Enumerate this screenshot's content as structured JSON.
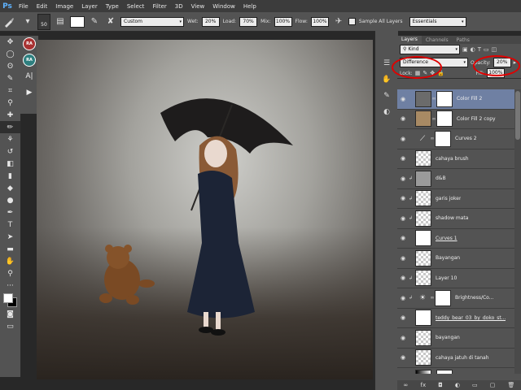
{
  "app": {
    "logo": "Ps"
  },
  "menu": [
    "File",
    "Edit",
    "Image",
    "Layer",
    "Type",
    "Select",
    "Filter",
    "3D",
    "View",
    "Window",
    "Help"
  ],
  "options": {
    "tool_icon": "brush-icon",
    "brush_size": "50",
    "preset": "Custom",
    "wet_label": "Wet:",
    "wet_value": "20%",
    "load_label": "Load:",
    "load_value": "70%",
    "mix_label": "Mix:",
    "mix_value": "100%",
    "flow_label": "Flow:",
    "flow_value": "100%",
    "sample_all_label": "Sample All Layers",
    "workspace": "Essentials"
  },
  "minipanel": {
    "badge1": "RA",
    "badge2": "RA"
  },
  "panel": {
    "tabs": [
      "Layers",
      "Channels",
      "Paths"
    ],
    "filter_kind": "Kind",
    "blend_mode": "Difference",
    "opacity_label": "Opacity:",
    "opacity_value": "20%",
    "lock_label": "Lock:",
    "fill_label": "Fill:",
    "fill_value": "100%"
  },
  "layers": [
    {
      "name": "Color Fill 2",
      "thumb": "gray",
      "mask": true,
      "clip": false,
      "active": true
    },
    {
      "name": "Color Fill 2 copy",
      "thumb": "brown",
      "mask": true,
      "clip": false,
      "active": false
    },
    {
      "name": "Curves 2",
      "thumb": "curves",
      "mask": true,
      "clip": false,
      "active": false
    },
    {
      "name": "cahaya brush",
      "thumb": "transparent",
      "mask": false,
      "clip": false,
      "active": false
    },
    {
      "name": "d&B",
      "thumb": "photo",
      "mask": false,
      "clip": true,
      "active": false
    },
    {
      "name": "garis joker",
      "thumb": "transparent",
      "mask": false,
      "clip": true,
      "active": false
    },
    {
      "name": "shadow mata",
      "thumb": "transparent",
      "mask": false,
      "clip": true,
      "active": false
    },
    {
      "name": "Curves 1",
      "thumb": "figure",
      "mask": false,
      "clip": false,
      "active": false
    },
    {
      "name": "Bayangan",
      "thumb": "transparent",
      "mask": false,
      "clip": false,
      "active": false
    },
    {
      "name": "Layer 10",
      "thumb": "transparent",
      "mask": false,
      "clip": true,
      "active": false
    },
    {
      "name": "Brightness/Co...",
      "thumb": "brightness",
      "mask": true,
      "clip": true,
      "active": false
    },
    {
      "name": "teddy_bear_03_by_doko_st...",
      "thumb": "bear",
      "mask": false,
      "clip": false,
      "active": false
    },
    {
      "name": "bayangan",
      "thumb": "transparent",
      "mask": false,
      "clip": false,
      "active": false
    },
    {
      "name": "cahaya jatuh di tanah",
      "thumb": "transparent",
      "mask": false,
      "clip": false,
      "active": false
    },
    {
      "name": "",
      "thumb": "gradient",
      "mask": true,
      "clip": false,
      "active": false
    }
  ],
  "panel_bottom": [
    "link-icon",
    "fx-icon",
    "mask-icon",
    "adjustment-icon",
    "folder-icon",
    "new-layer-icon",
    "trash-icon"
  ]
}
